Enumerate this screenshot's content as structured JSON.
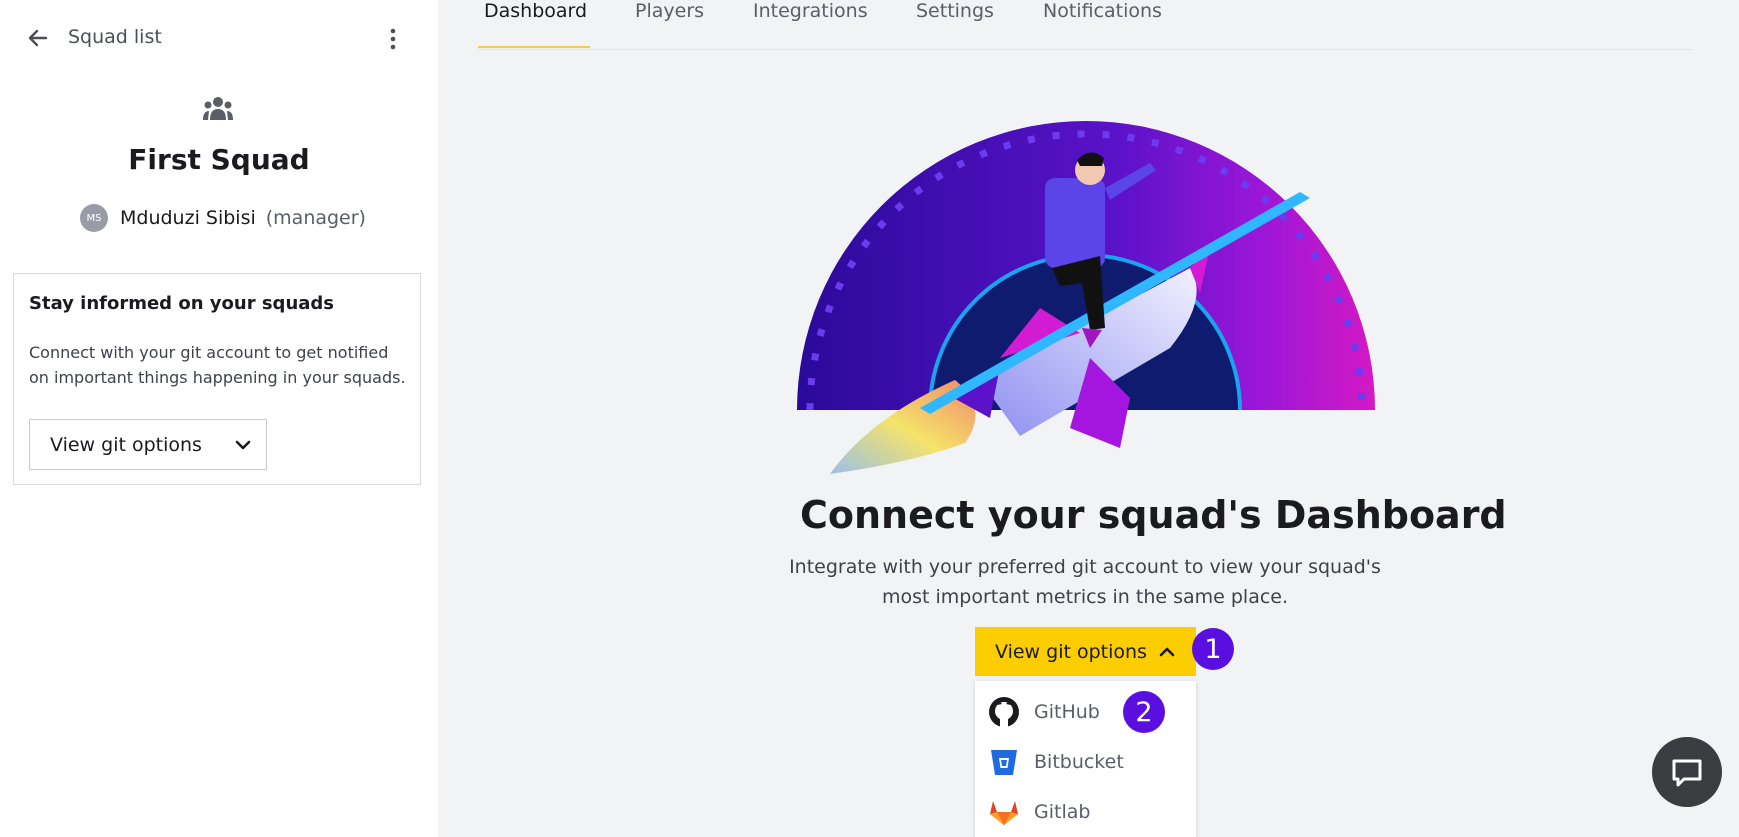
{
  "sidebar": {
    "back_label": "Squad list",
    "squad_name": "First Squad",
    "manager": {
      "initials": "MS",
      "name": "Mduduzi Sibisi",
      "role": "(manager)"
    },
    "card": {
      "title": "Stay informed on your squads",
      "text": "Connect with your git account to get notified on important things happening in your squads.",
      "button_label": "View git options"
    }
  },
  "tabs": [
    {
      "label": "Dashboard",
      "active": true
    },
    {
      "label": "Players"
    },
    {
      "label": "Integrations"
    },
    {
      "label": "Settings"
    },
    {
      "label": "Notifications"
    }
  ],
  "main": {
    "title": "Connect your squad's Dashboard",
    "subtitle": "Integrate with your preferred git account to view your squad's most important metrics in the same place.",
    "button_label": "View git options",
    "markers": [
      "1",
      "2"
    ],
    "dropdown": [
      {
        "label": "GitHub",
        "icon": "github-icon"
      },
      {
        "label": "Bitbucket",
        "icon": "bitbucket-icon"
      },
      {
        "label": "Gitlab",
        "icon": "gitlab-icon"
      }
    ]
  },
  "colors": {
    "accent": "#fccd00",
    "marker": "#5a0ee0",
    "tab_underline": "#f7cd3c"
  }
}
